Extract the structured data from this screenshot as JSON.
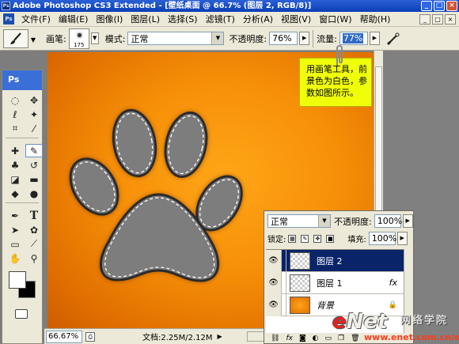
{
  "window": {
    "title": "Adobe Photoshop CS3 Extended - [壁纸桌面 @ 66.7% (图层 2, RGB/8)]",
    "app_icon": "Ps",
    "minimize": "_",
    "maximize": "□",
    "close": "×"
  },
  "menu": {
    "items": [
      "文件(F)",
      "编辑(E)",
      "图像(I)",
      "图层(L)",
      "选择(S)",
      "滤镜(T)",
      "分析(A)",
      "视图(V)",
      "窗口(W)",
      "帮助(H)"
    ]
  },
  "options_bar": {
    "brush_label": "画笔:",
    "brush_size": "175",
    "mode_label": "模式:",
    "mode_value": "正常",
    "opacity_label": "不透明度:",
    "opacity_value": "76%",
    "flow_label": "流量:",
    "flow_value": "77%",
    "tool_icon": "brush-icon",
    "airbrush_icon": "airbrush-icon"
  },
  "toolbox": {
    "header": "Ps"
  },
  "callout": {
    "text": "用画笔工具，前景色为白色，参数如图所示。"
  },
  "layers_panel": {
    "blend_mode": "正常",
    "opacity_label": "不透明度:",
    "opacity_value": "100%",
    "lock_label": "锁定:",
    "fill_label": "填充:",
    "fill_value": "100%",
    "layers": [
      {
        "name": "图层 2",
        "selected": true,
        "thumbnail": "transparent"
      },
      {
        "name": "图层 1",
        "selected": false,
        "thumbnail": "transparent",
        "fx": "fx"
      },
      {
        "name": "背景",
        "selected": false,
        "thumbnail": "orange",
        "locked": true
      }
    ]
  },
  "status_bar": {
    "zoom": "66.67%",
    "doc_info": "文档:2.25M/2.12M"
  },
  "watermark": {
    "logo": "eNet",
    "cn": "网络学院",
    "url": "www.enet.com.cn/eschool"
  },
  "colors": {
    "foreground": "#ffffff",
    "background": "#000000",
    "canvas_orange": "#f68f07",
    "callout_yellow": "#f0ff09",
    "selected_layer": "#0a246a"
  }
}
